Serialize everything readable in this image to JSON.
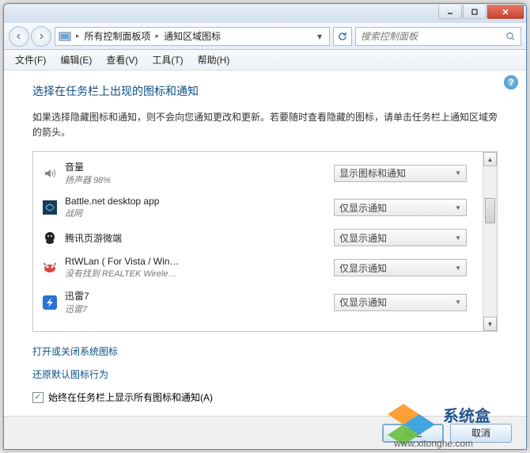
{
  "breadcrumb": {
    "root": "所有控制面板项",
    "current": "通知区域图标"
  },
  "search": {
    "placeholder": "搜索控制面板"
  },
  "menu": {
    "file": "文件(F)",
    "edit": "编辑(E)",
    "view": "查看(V)",
    "tools": "工具(T)",
    "help": "帮助(H)"
  },
  "heading": "选择在任务栏上出现的图标和通知",
  "description": "如果选择隐藏图标和通知，则不会向您通知更改和更新。若要随时查看隐藏的图标，请单击任务栏上通知区域旁的箭头。",
  "options": {
    "show_icon_and_notify": "显示图标和通知",
    "only_notify": "仅显示通知"
  },
  "items": [
    {
      "name": "音量",
      "sub": "扬声器 98%",
      "mode": "show_icon_and_notify"
    },
    {
      "name": "Battle.net desktop app",
      "sub": "战网",
      "mode": "only_notify"
    },
    {
      "name": "腾讯页游微端",
      "sub": "",
      "mode": "only_notify"
    },
    {
      "name": "RtWLan ( For Vista / Win…",
      "sub": "没有找到 REALTEK Wirele…",
      "mode": "only_notify"
    },
    {
      "name": "迅雷7",
      "sub": "迅雷7",
      "mode": "only_notify"
    }
  ],
  "links": {
    "system_icons": "打开或关闭系统图标",
    "restore_defaults": "还原默认图标行为"
  },
  "checkbox": {
    "label": "始终在任务栏上显示所有图标和通知(A)",
    "checked": true
  },
  "buttons": {
    "ok": "确定",
    "cancel": "取消"
  },
  "watermark": "www.xitonghe.com"
}
